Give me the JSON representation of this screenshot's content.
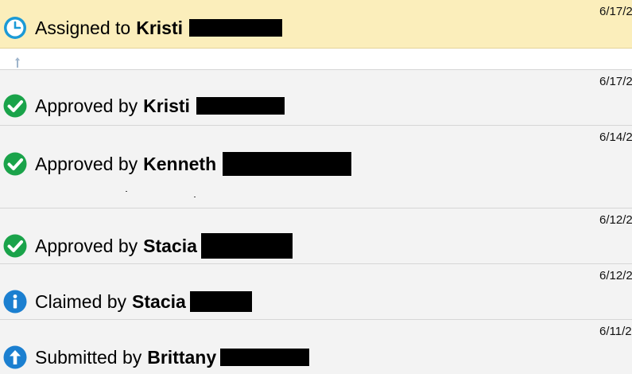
{
  "events": [
    {
      "kind": "assigned",
      "icon": "clock-icon",
      "action": "Assigned to",
      "actor": "Kristi",
      "date": "6/17/2"
    },
    {
      "kind": "approved",
      "icon": "checkmark-icon",
      "action": "Approved by",
      "actor": "Kristi",
      "date": "6/17/2"
    },
    {
      "kind": "approved",
      "icon": "checkmark-icon",
      "action": "Approved by",
      "actor": "Kenneth",
      "date": "6/14/2"
    },
    {
      "kind": "approved",
      "icon": "checkmark-icon",
      "action": "Approved by",
      "actor": "Stacia",
      "date": "6/12/2"
    },
    {
      "kind": "claimed",
      "icon": "info-icon",
      "action": "Claimed by",
      "actor": "Stacia",
      "date": "6/12/2"
    },
    {
      "kind": "submitted",
      "icon": "up-arrow-icon",
      "action": "Submitted by",
      "actor": "Brittany",
      "date": "6/11/2"
    }
  ],
  "colors": {
    "assigned_bg": "#fbeebb",
    "row_bg": "#f3f3f3",
    "clock_blue": "#1b9ad6",
    "check_green": "#1aa34a",
    "info_blue": "#1b7fd0"
  }
}
